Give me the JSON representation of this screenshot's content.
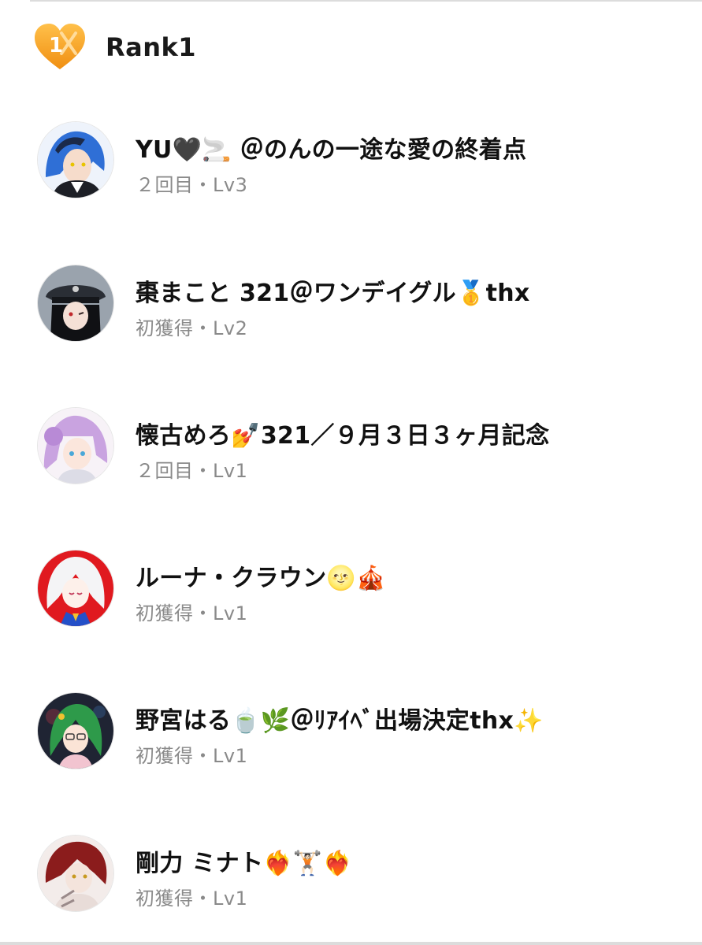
{
  "header": {
    "title": "Rank1",
    "badge_icon": "rank1-heart-badge-icon",
    "badge_color": "#f4a623",
    "badge_numeral": "1"
  },
  "entries": [
    {
      "name": "YU🖤🚬 ＠のんの一途な愛の終着点",
      "meta": "２回目・Lv3",
      "avatar_color": "#2f6fd6"
    },
    {
      "name": "棗まこと 321＠ワンデイグル🥇thx",
      "meta": "初獲得・Lv2",
      "avatar_color": "#3a3f47"
    },
    {
      "name": "懐古めろ💅321／９月３日３ヶ月記念",
      "meta": "２回目・Lv1",
      "avatar_color": "#c9a3e0"
    },
    {
      "name": "ルーナ・クラウン🌝🎪",
      "meta": "初獲得・Lv1",
      "avatar_color": "#e0191f"
    },
    {
      "name": "野宮はる🍵🌿＠ﾘｱｲﾍﾞ出場決定thx✨",
      "meta": "初獲得・Lv1",
      "avatar_color": "#2e7d4a"
    },
    {
      "name": "剛力 ミナト❤️‍🔥🏋🏻❤️‍🔥",
      "meta": "初獲得・Lv1",
      "avatar_color": "#8b1c1c"
    }
  ],
  "colors": {
    "name_text": "#111111",
    "meta_text": "#8a8a8a",
    "divider": "#dcdcdc"
  }
}
